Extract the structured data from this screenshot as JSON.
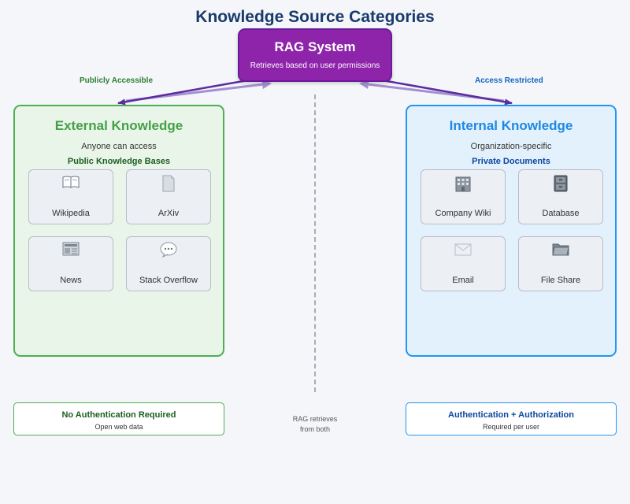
{
  "title": "Knowledge Source Categories",
  "rag": {
    "title": "RAG System",
    "subtitle": "Retrieves based on user permissions"
  },
  "labels": {
    "left": "Publicly Accessible",
    "right": "Access Restricted"
  },
  "external": {
    "title": "External Knowledge",
    "subtitle": "Anyone can access",
    "section": "Public Knowledge Bases",
    "items": [
      {
        "label": "Wikipedia",
        "icon": "book-icon"
      },
      {
        "label": "ArXiv",
        "icon": "document-icon"
      },
      {
        "label": "News",
        "icon": "newspaper-icon"
      },
      {
        "label": "Stack Overflow",
        "icon": "speech-bubble-icon"
      }
    ],
    "footer": {
      "title": "No Authentication Required",
      "subtitle": "Open web data"
    }
  },
  "internal": {
    "title": "Internal Knowledge",
    "subtitle": "Organization-specific",
    "section": "Private Documents",
    "items": [
      {
        "label": "Company Wiki",
        "icon": "office-building-icon"
      },
      {
        "label": "Database",
        "icon": "file-cabinet-icon"
      },
      {
        "label": "Email",
        "icon": "envelope-icon"
      },
      {
        "label": "File Share",
        "icon": "folder-icon"
      }
    ],
    "footer": {
      "title": "Authentication + Authorization",
      "subtitle": "Required per user"
    }
  },
  "center_note": [
    "RAG retrieves",
    "from both"
  ],
  "colors": {
    "title": "#1a3a6b",
    "rag": "#8e24aa",
    "external": "#4caf50",
    "internal": "#2196f3",
    "arrow": "#5e35b1"
  }
}
